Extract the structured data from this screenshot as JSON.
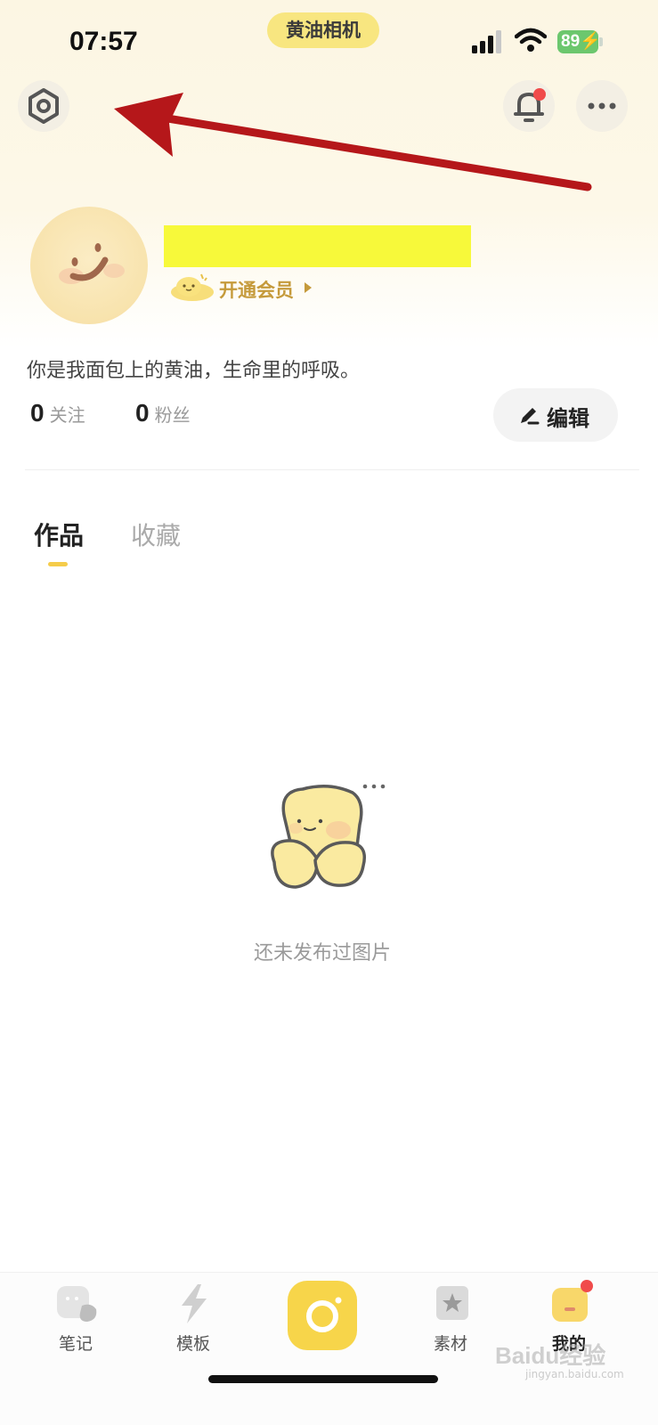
{
  "status_bar": {
    "time": "07:57",
    "app_name": "黄油相机",
    "battery": "89"
  },
  "header": {
    "settings_icon": "settings-hexagon-icon",
    "notification_icon": "bell-icon",
    "more_icon": "more-dots-icon",
    "notification_has_badge": true
  },
  "profile": {
    "vip_label": "开通会员",
    "bio": "你是我面包上的黄油，生命里的呼吸。",
    "following_count": "0",
    "following_label": "关注",
    "fans_count": "0",
    "fans_label": "粉丝",
    "edit_label": "编辑"
  },
  "tabs": [
    {
      "label": "作品",
      "active": true
    },
    {
      "label": "收藏",
      "active": false
    }
  ],
  "empty_state": {
    "message": "还未发布过图片"
  },
  "bottom_nav": [
    {
      "label": "笔记",
      "icon": "notes-icon"
    },
    {
      "label": "模板",
      "icon": "templates-icon"
    },
    {
      "label": "",
      "icon": "camera-icon"
    },
    {
      "label": "素材",
      "icon": "materials-icon"
    },
    {
      "label": "我的",
      "icon": "profile-icon",
      "active": true
    }
  ],
  "watermark": {
    "text": "Baidu经验",
    "sub": "jingyan.baidu.com"
  },
  "colors": {
    "accent_yellow": "#f7d54a",
    "vip_gold": "#c59a3b",
    "badge_red": "#f04b4b",
    "annotation_arrow": "#b5171a",
    "redaction_yellow": "#f7f93a"
  }
}
